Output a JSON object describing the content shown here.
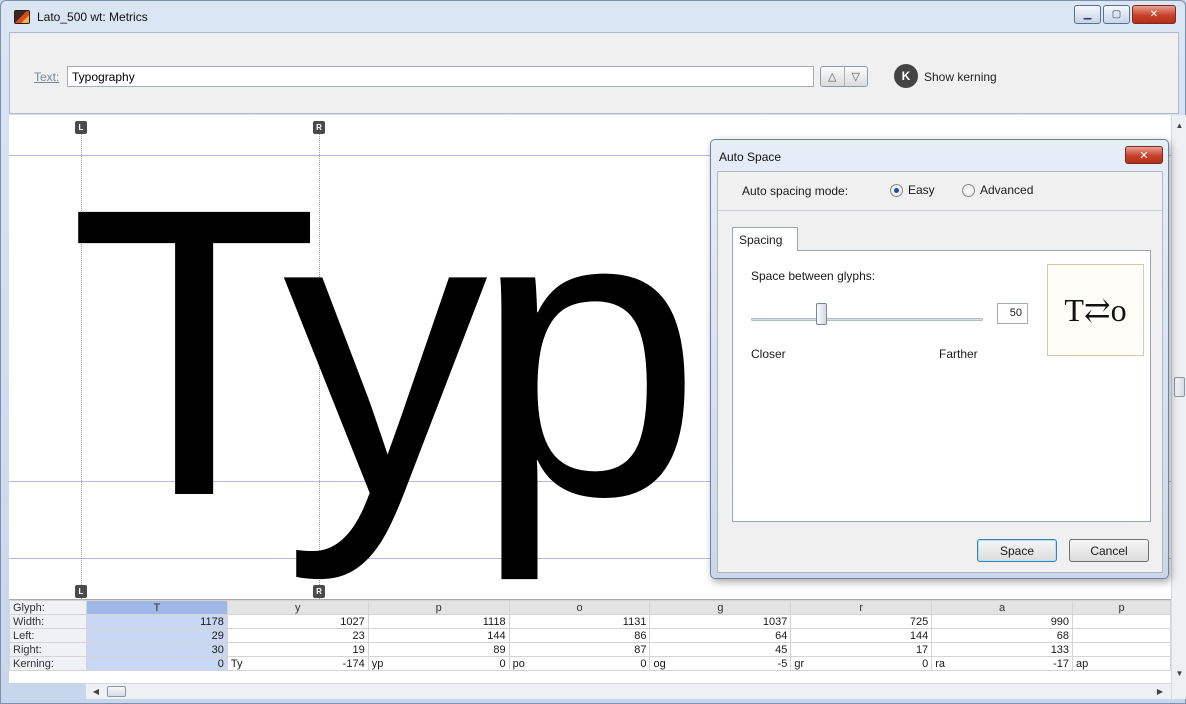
{
  "window": {
    "title": "Lato_500 wt: Metrics",
    "minimize_glyph": "▁",
    "maximize_glyph": "▢",
    "close_glyph": "✕"
  },
  "toolbar": {
    "text_label": "Text:",
    "text_value": "Typography",
    "prev_glyph": "△",
    "next_glyph": "▽",
    "kerning_icon_letter": "K",
    "show_kerning_label": "Show kerning"
  },
  "canvas": {
    "glyphs": "Typ",
    "left_marker": "L",
    "right_marker": "R"
  },
  "metrics": {
    "row_labels": {
      "glyph": "Glyph:",
      "width": "Width:",
      "left": "Left:",
      "right": "Right:",
      "kerning": "Kerning:"
    },
    "columns": [
      {
        "glyph": "T",
        "width": "1178",
        "left": "29",
        "right": "30",
        "pair": "",
        "kerning": "0"
      },
      {
        "glyph": "y",
        "width": "1027",
        "left": "23",
        "right": "19",
        "pair": "Ty",
        "kerning": "-174"
      },
      {
        "glyph": "p",
        "width": "1118",
        "left": "144",
        "right": "89",
        "pair": "yp",
        "kerning": "0"
      },
      {
        "glyph": "o",
        "width": "1131",
        "left": "86",
        "right": "87",
        "pair": "po",
        "kerning": "0"
      },
      {
        "glyph": "g",
        "width": "1037",
        "left": "64",
        "right": "45",
        "pair": "og",
        "kerning": "-5"
      },
      {
        "glyph": "r",
        "width": "725",
        "left": "144",
        "right": "17",
        "pair": "gr",
        "kerning": "0"
      },
      {
        "glyph": "a",
        "width": "990",
        "left": "68",
        "right": "133",
        "pair": "ra",
        "kerning": "-17"
      },
      {
        "glyph": "p",
        "width": "",
        "left": "",
        "right": "",
        "pair": "ap",
        "kerning": ""
      }
    ],
    "selected_column": 0
  },
  "dialog": {
    "title": "Auto Space",
    "close_glyph": "✕",
    "mode_label": "Auto spacing mode:",
    "mode_easy": "Easy",
    "mode_advanced": "Advanced",
    "selected_mode": "Easy",
    "tab_label": "Spacing",
    "space_label": "Space between glyphs:",
    "slider_value": "50",
    "slider_fraction": 0.3,
    "closer_label": "Closer",
    "farther_label": "Farther",
    "preview_text": "T⇄o",
    "space_button": "Space",
    "cancel_button": "Cancel"
  },
  "scroll": {
    "up_glyph": "▲",
    "down_glyph": "▼",
    "left_glyph": "◀",
    "right_glyph": "▶"
  }
}
